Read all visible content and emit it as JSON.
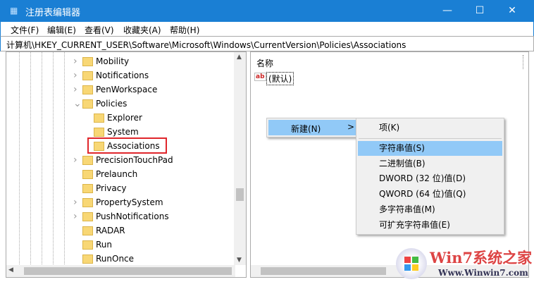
{
  "window": {
    "title": "注册表编辑器",
    "minimize": "—",
    "maximize": "☐",
    "close": "✕"
  },
  "menubar": [
    "文件(F)",
    "编辑(E)",
    "查看(V)",
    "收藏夹(A)",
    "帮助(H)"
  ],
  "address": "计算机\\HKEY_CURRENT_USER\\Software\\Microsoft\\Windows\\CurrentVersion\\Policies\\Associations",
  "tree": [
    {
      "label": "Mobility",
      "level": 1,
      "expander": ">"
    },
    {
      "label": "Notifications",
      "level": 1,
      "expander": ">"
    },
    {
      "label": "PenWorkspace",
      "level": 1,
      "expander": ">"
    },
    {
      "label": "Policies",
      "level": 1,
      "expander": "v"
    },
    {
      "label": "Explorer",
      "level": 2,
      "expander": ""
    },
    {
      "label": "System",
      "level": 2,
      "expander": ""
    },
    {
      "label": "Associations",
      "level": 2,
      "expander": "",
      "selected": true
    },
    {
      "label": "PrecisionTouchPad",
      "level": 1,
      "expander": ">"
    },
    {
      "label": "Prelaunch",
      "level": 1,
      "expander": ""
    },
    {
      "label": "Privacy",
      "level": 1,
      "expander": ""
    },
    {
      "label": "PropertySystem",
      "level": 1,
      "expander": ">"
    },
    {
      "label": "PushNotifications",
      "level": 1,
      "expander": ">"
    },
    {
      "label": "RADAR",
      "level": 1,
      "expander": ""
    },
    {
      "label": "Run",
      "level": 1,
      "expander": ""
    },
    {
      "label": "RunOnce",
      "level": 1,
      "expander": ""
    }
  ],
  "right": {
    "column_name": "名称",
    "default_value": "(默认)",
    "value_icon": "ab"
  },
  "context_menu": {
    "new_label": "新建(N)",
    "arrow": ">"
  },
  "submenu": [
    "项(K)",
    "字符串值(S)",
    "二进制值(B)",
    "DWORD (32 位)值(D)",
    "QWORD (64 位)值(Q)",
    "多字符串值(M)",
    "可扩充字符串值(E)"
  ],
  "watermark": {
    "title": "Win7系统之家",
    "url": "Www.Winwin7.com"
  },
  "colors": {
    "titlebar": "#1a7fd4",
    "highlight": "#91c9f7",
    "selection_box": "#e0262b"
  }
}
